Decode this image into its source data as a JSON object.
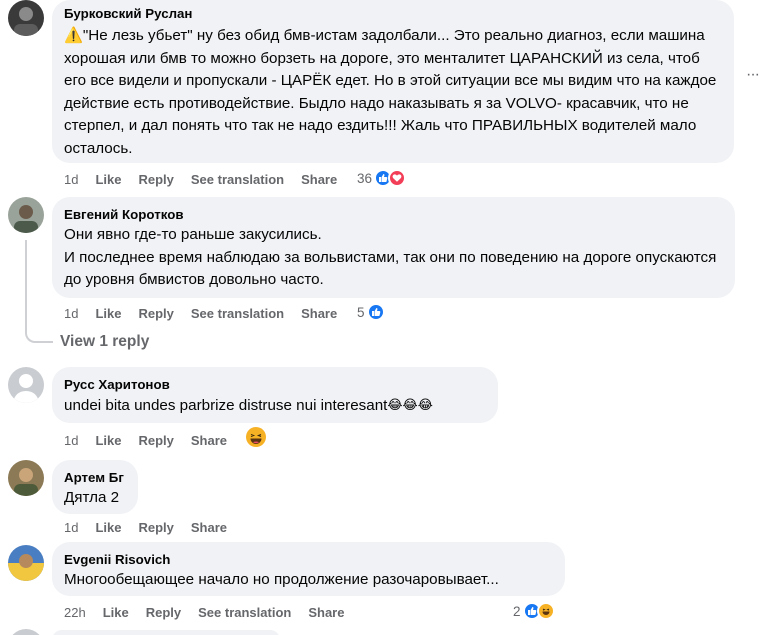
{
  "comments": [
    {
      "author": "Бурковский Руслан",
      "text": "⚠️\"Не лезь убьет\" ну без обид бмв-истам задолбали... Это реально диагноз, если машина хорошая или бмв то можно борзеть на дороге, это менталитет ЦАРАНСКИЙ из села, чтоб его все видели и пропускали - ЦАРЁК едет. Но в этой ситуации все мы видим что на каждое действие есть противодействие. Быдло надо наказывать я за VOLVO- красавчик, что не стерпел, и дал понять что так не надо ездить!!! Жаль что ПРАВИЛЬНЫХ водителей мало осталось.",
      "time": "1d",
      "like": "Like",
      "reply": "Reply",
      "translate": "See translation",
      "share": "Share",
      "reaction_count": "36",
      "reactions": [
        "like-reaction-icon",
        "love-reaction-icon"
      ]
    },
    {
      "author": "Евгений Коротков",
      "text": "Они явно где-то раньше закусились.\nИ последнее время наблюдаю за вольвистами, так они по поведению на дороге опускаются до уровня бмвистов довольно часто.",
      "time": "1d",
      "like": "Like",
      "reply": "Reply",
      "translate": "See translation",
      "share": "Share",
      "reaction_count": "5",
      "reactions": [
        "like-reaction-icon"
      ]
    },
    {
      "author": "Русс Харитонов",
      "text": "undei bita undes parbrize distruse nui interesant",
      "text_emojis": "😂😂😂",
      "time": "1d",
      "like": "Like",
      "reply": "Reply",
      "share": "Share",
      "reactions": [
        "haha-reaction-icon"
      ]
    },
    {
      "author": "Артем Бг",
      "text": "Дятла 2",
      "time": "1d",
      "like": "Like",
      "reply": "Reply",
      "share": "Share"
    },
    {
      "author": "Evgenii Risovich",
      "text": "Многообещающее начало но продолжение разочаровывает...",
      "time": "22h",
      "like": "Like",
      "reply": "Reply",
      "translate": "See translation",
      "share": "Share",
      "reaction_count": "2",
      "reactions": [
        "like-reaction-icon",
        "haha-reaction-icon"
      ]
    }
  ],
  "view_reply": "View 1 reply",
  "colors": {
    "bubble": "#f0f2f5",
    "meta": "#65676b",
    "like_blue": "#1877f2",
    "love_red": "#f33e58",
    "haha_yellow": "#f7b125"
  }
}
